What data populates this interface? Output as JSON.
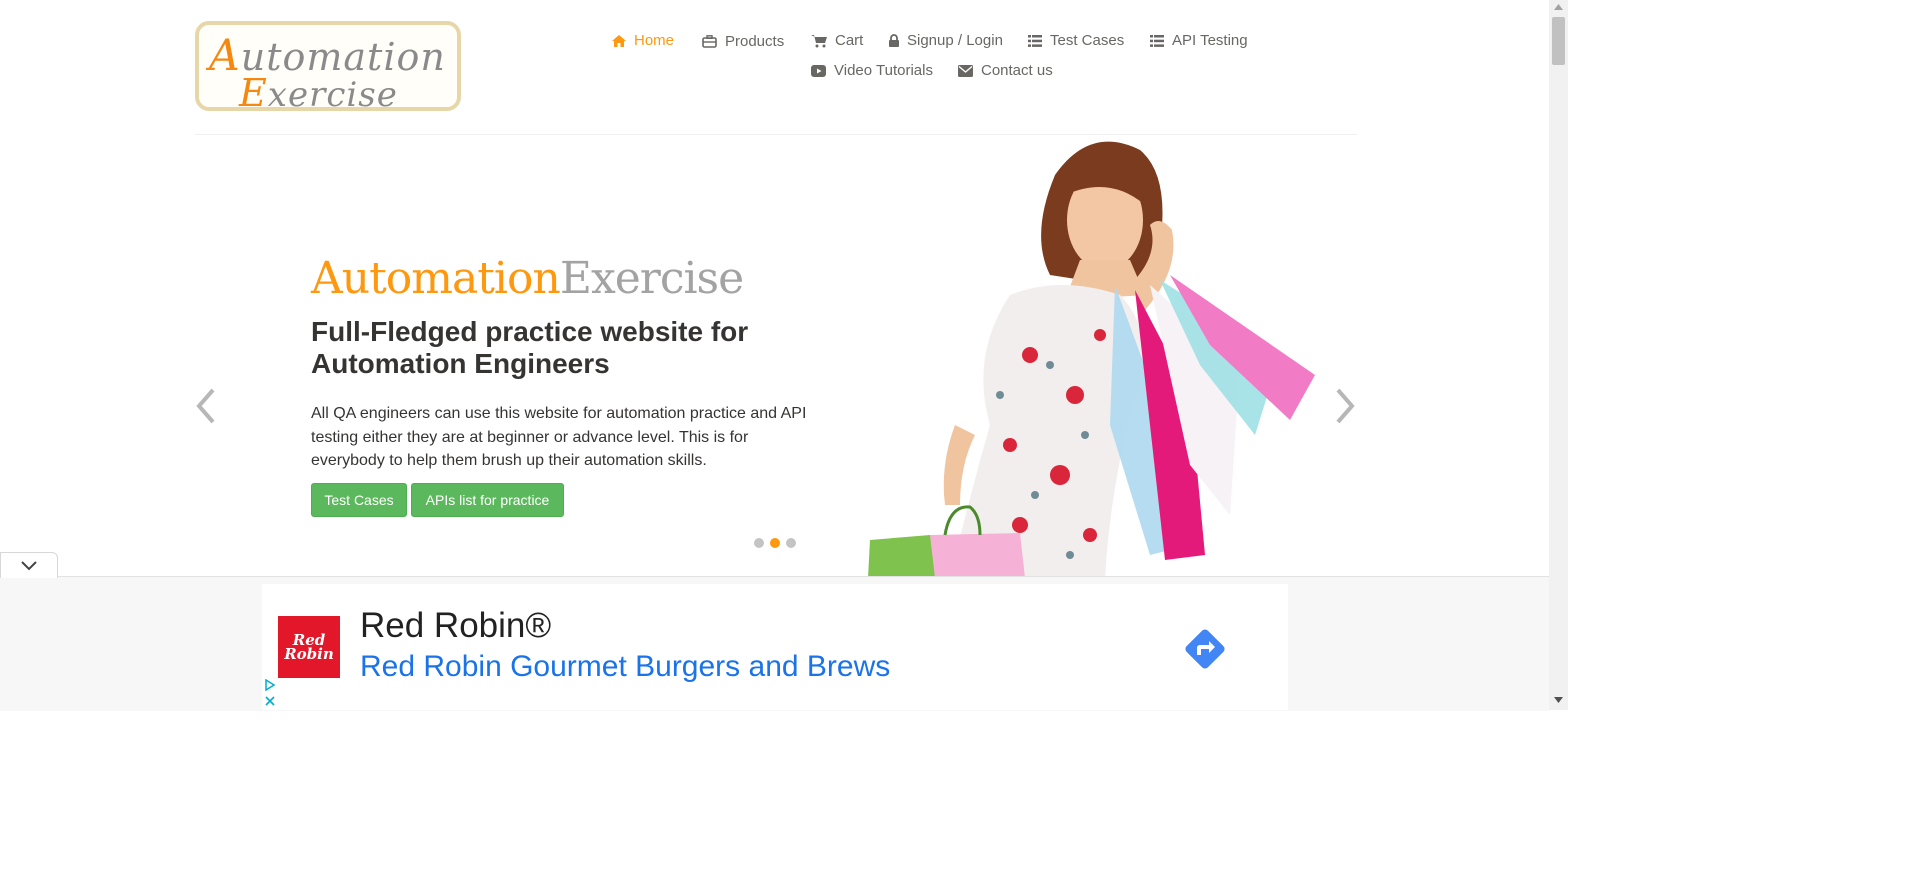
{
  "logo": {
    "line1_cap": "A",
    "line1_rest": "utomation",
    "line2_cap": "E",
    "line2_rest": "xercise"
  },
  "nav": {
    "home": "Home",
    "products": "Products",
    "cart": "Cart",
    "signup": "Signup / Login",
    "test_cases": "Test Cases",
    "api_testing": "API Testing",
    "video": "Video Tutorials",
    "contact": "Contact us"
  },
  "hero": {
    "title_part1": "Automation",
    "title_part2": "Exercise",
    "heading": "Full-Fledged practice website for Automation Engineers",
    "description": "All QA engineers can use this website for automation practice and API testing either they are at beginner or advance level. This is for everybody to help them brush up their automation skills.",
    "btn_test_cases": "Test Cases",
    "btn_apis": "APIs list for practice",
    "slides": 3,
    "active_slide": 2
  },
  "ad": {
    "logo_line1": "Red",
    "logo_line2": "Robin",
    "brand": "Red Robin®",
    "headline": "Red Robin Gourmet Burgers and Brews"
  },
  "colors": {
    "accent": "#FE980F",
    "button": "#5cb85c",
    "ad_link": "#1a73e8",
    "ad_go": "#4285f4"
  }
}
